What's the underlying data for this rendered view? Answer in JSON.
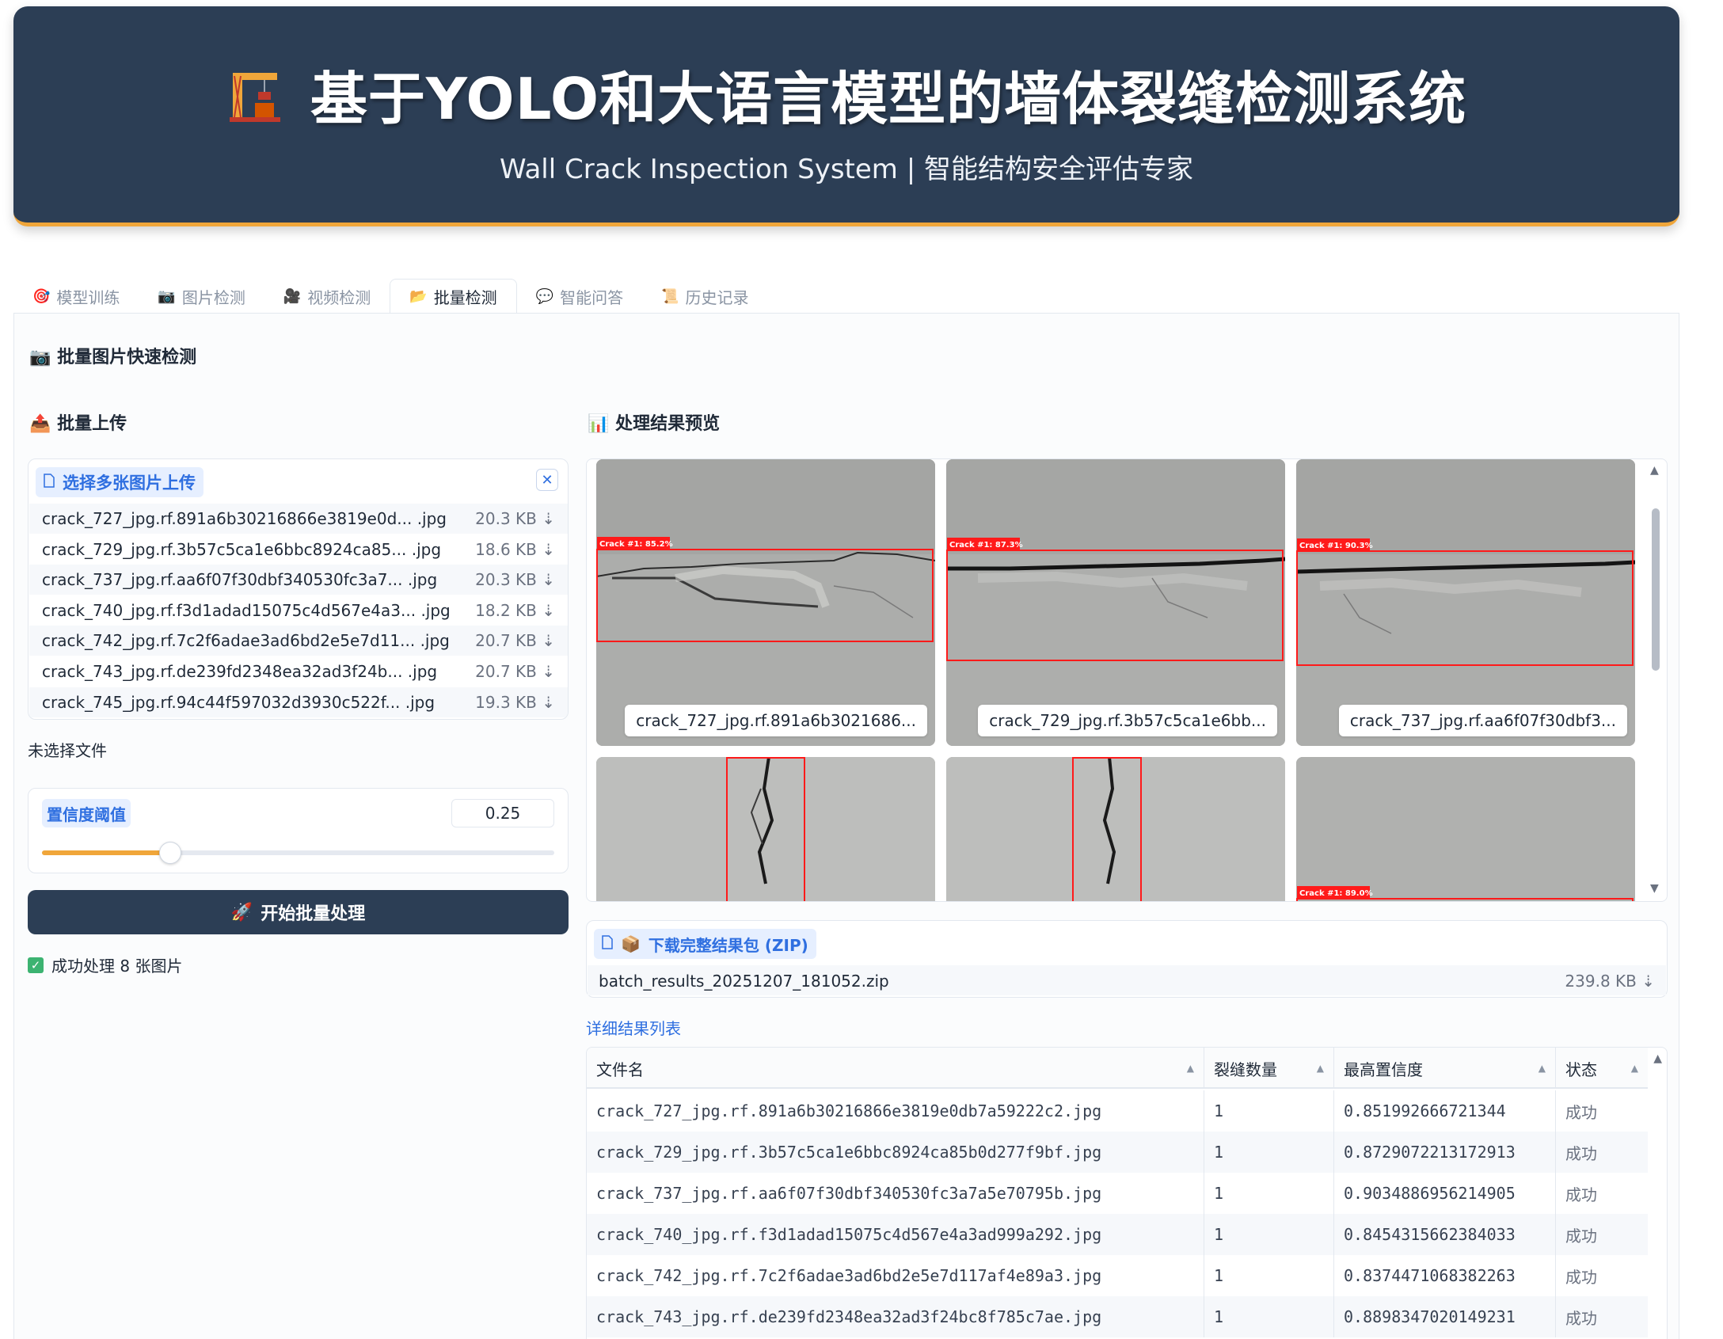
{
  "header": {
    "title": "基于YOLO和大语言模型的墙体裂缝检测系统",
    "subtitle": "Wall Crack Inspection System | 智能结构安全评估专家",
    "logo_icon": "crane-icon"
  },
  "tabs": [
    {
      "icon": "🎯",
      "label": "模型训练"
    },
    {
      "icon": "📷",
      "label": "图片检测"
    },
    {
      "icon": "🎥",
      "label": "视频检测"
    },
    {
      "icon": "📂",
      "label": "批量检测"
    },
    {
      "icon": "💬",
      "label": "智能问答"
    },
    {
      "icon": "📜",
      "label": "历史记录"
    }
  ],
  "active_tab": "批量检测",
  "page_title": {
    "icon": "📷",
    "label": "批量图片快速检测"
  },
  "upload_section": {
    "icon": "📤",
    "label": "批量上传"
  },
  "preview_section": {
    "icon": "📊",
    "label": "处理结果预览"
  },
  "upload": {
    "label": "选择多张图片上传",
    "files": [
      {
        "name": "crack_727_jpg.rf.891a6b30216866e3819e0d...  .jpg",
        "size": "20.3 KB ⇣"
      },
      {
        "name": "crack_729_jpg.rf.3b57c5ca1e6bbc8924ca85...  .jpg",
        "size": "18.6 KB ⇣"
      },
      {
        "name": "crack_737_jpg.rf.aa6f07f30dbf340530fc3a7...  .jpg",
        "size": "20.3 KB ⇣"
      },
      {
        "name": "crack_740_jpg.rf.f3d1adad15075c4d567e4a3... .jpg",
        "size": "18.2 KB ⇣"
      },
      {
        "name": "crack_742_jpg.rf.7c2f6adae3ad6bd2e5e7d11... .jpg",
        "size": "20.7 KB ⇣"
      },
      {
        "name": "crack_743_jpg.rf.de239fd2348ea32ad3f24b...  .jpg",
        "size": "20.7 KB ⇣"
      },
      {
        "name": "crack_745_jpg.rf.94c44f597032d3930c522f...  .jpg",
        "size": "19.3 KB ⇣"
      }
    ]
  },
  "no_file_text": "未选择文件",
  "threshold": {
    "label": "置信度阈值",
    "value": "0.25",
    "min": 0,
    "max": 1
  },
  "run_button": {
    "icon": "🚀",
    "label": "开始批量处理"
  },
  "status_text": "成功处理 8 张图片",
  "gallery": [
    {
      "caption": "crack_727_jpg.rf.891a6b3021686...",
      "box_label": "Crack #1: 85.2%"
    },
    {
      "caption": "crack_729_jpg.rf.3b57c5ca1e6bb...",
      "box_label": "Crack #1: 87.3%"
    },
    {
      "caption": "crack_737_jpg.rf.aa6f07f30dbf3...",
      "box_label": "Crack #1: 90.3%"
    },
    {
      "caption": "",
      "box_label": ""
    },
    {
      "caption": "",
      "box_label": ""
    },
    {
      "caption": "",
      "box_label": "Crack #1: 89.0%"
    }
  ],
  "download": {
    "label": "下载完整结果包 (ZIP)",
    "icon": "📦",
    "file": "batch_results_20251207_181052.zip",
    "size": "239.8 KB ⇣"
  },
  "table_title": "详细结果列表",
  "table": {
    "headers": [
      "文件名",
      "裂缝数量",
      "最高置信度",
      "状态"
    ],
    "rows": [
      [
        "crack_727_jpg.rf.891a6b30216866e3819e0db7a59222c2.jpg",
        "1",
        "0.851992666721344",
        "成功"
      ],
      [
        "crack_729_jpg.rf.3b57c5ca1e6bbc8924ca85b0d277f9bf.jpg",
        "1",
        "0.8729072213172913",
        "成功"
      ],
      [
        "crack_737_jpg.rf.aa6f07f30dbf340530fc3a7a5e70795b.jpg",
        "1",
        "0.9034886956214905",
        "成功"
      ],
      [
        "crack_740_jpg.rf.f3d1adad15075c4d567e4a3ad999a292.jpg",
        "1",
        "0.8454315662384033",
        "成功"
      ],
      [
        "crack_742_jpg.rf.7c2f6adae3ad6bd2e5e7d117af4e89a3.jpg",
        "1",
        "0.8374471068382263",
        "成功"
      ],
      [
        "crack_743_jpg.rf.de239fd2348ea32ad3f24bc8f785c7ae.jpg",
        "1",
        "0.8898347020149231",
        "成功"
      ]
    ]
  },
  "colors": {
    "header_bg": "#2c3e55",
    "accent": "#f0a63a",
    "link": "#2f6fe0",
    "box": "#ff1a1a"
  }
}
